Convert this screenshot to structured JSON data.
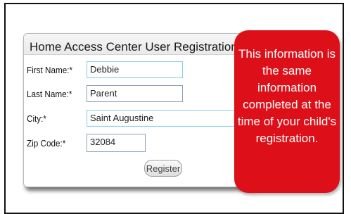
{
  "form": {
    "title": "Home Access Center User Registration",
    "fields": [
      {
        "label": "First Name:*",
        "value": "Debbie"
      },
      {
        "label": "Last Name:*",
        "value": "Parent"
      },
      {
        "label": "City:*",
        "value": "Saint Augustine"
      },
      {
        "label": "Zip Code:*",
        "value": "32084"
      }
    ],
    "register_label": "Register"
  },
  "callout": {
    "text": "This information is the same information completed at the time of your child's registration.",
    "color": "#dd1019"
  }
}
